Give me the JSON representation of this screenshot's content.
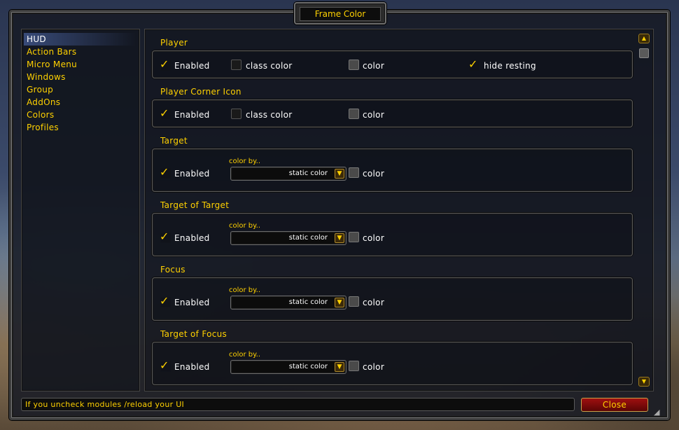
{
  "window": {
    "title": "Frame Color"
  },
  "sidebar": {
    "items": [
      {
        "label": "HUD",
        "selected": true
      },
      {
        "label": "Action Bars"
      },
      {
        "label": "Micro Menu"
      },
      {
        "label": "Windows"
      },
      {
        "label": "Group"
      },
      {
        "label": "AddOns"
      },
      {
        "label": "Colors"
      },
      {
        "label": "Profiles"
      }
    ]
  },
  "sections": {
    "player": {
      "title": "Player",
      "enabled": {
        "label": "Enabled",
        "checked": true
      },
      "class_color": {
        "label": "class color",
        "checked": false
      },
      "color": {
        "label": "color"
      },
      "hide_resting": {
        "label": "hide resting",
        "checked": true
      }
    },
    "player_corner_icon": {
      "title": "Player Corner Icon",
      "enabled": {
        "label": "Enabled",
        "checked": true
      },
      "class_color": {
        "label": "class color",
        "checked": false
      },
      "color": {
        "label": "color"
      }
    },
    "target": {
      "title": "Target",
      "enabled": {
        "label": "Enabled",
        "checked": true
      },
      "color_by_label": "color by..",
      "color_by_value": "static color",
      "color": {
        "label": "color"
      }
    },
    "target_of_target": {
      "title": "Target of Target",
      "enabled": {
        "label": "Enabled",
        "checked": true
      },
      "color_by_label": "color by..",
      "color_by_value": "static color",
      "color": {
        "label": "color"
      }
    },
    "focus": {
      "title": "Focus",
      "enabled": {
        "label": "Enabled",
        "checked": true
      },
      "color_by_label": "color by..",
      "color_by_value": "static color",
      "color": {
        "label": "color"
      }
    },
    "target_of_focus": {
      "title": "Target of Focus",
      "enabled": {
        "label": "Enabled",
        "checked": true
      },
      "color_by_label": "color by..",
      "color_by_value": "static color",
      "color": {
        "label": "color"
      }
    }
  },
  "footer": {
    "status_text": "If you uncheck modules /reload your UI",
    "close_label": "Close"
  },
  "icons": {
    "check": "✓",
    "dropdown_arrow": "▼",
    "scroll_up": "▲",
    "scroll_down": "▼",
    "resize_grip": "◢"
  },
  "colors": {
    "accent_gold": "#ffd100",
    "text_white": "#ffffff",
    "close_red": "#8b0a0a"
  }
}
